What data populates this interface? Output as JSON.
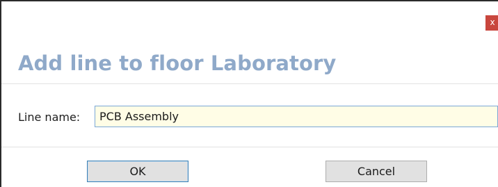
{
  "dialog": {
    "close_label": "x",
    "title": "Add line to floor Laboratory",
    "field": {
      "label": "Line name:",
      "value": "PCB Assembly"
    },
    "buttons": {
      "ok": "OK",
      "cancel": "Cancel"
    }
  },
  "colors": {
    "title": "#8fa9c9",
    "close_button": "#c9463d",
    "input_background": "#fffde6",
    "input_border": "#7aa7d6",
    "button_face": "#e1e1e1",
    "default_button_border": "#3c7fb1"
  }
}
